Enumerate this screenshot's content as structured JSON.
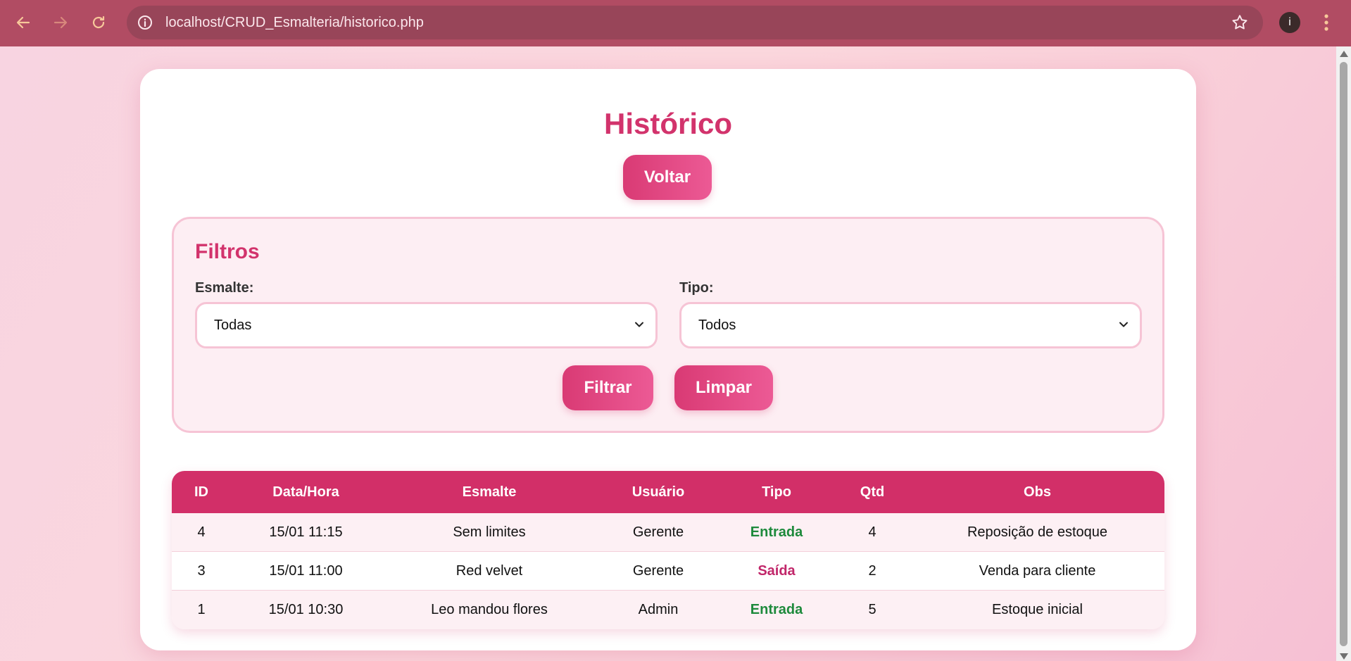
{
  "browser": {
    "url": "localhost/CRUD_Esmalteria/historico.php",
    "profile_initial": "i"
  },
  "page": {
    "title": "Histórico",
    "back_label": "Voltar"
  },
  "filters": {
    "heading": "Filtros",
    "esmalte_label": "Esmalte:",
    "esmalte_value": "Todas",
    "tipo_label": "Tipo:",
    "tipo_value": "Todos",
    "filter_button": "Filtrar",
    "clear_button": "Limpar"
  },
  "table": {
    "headers": [
      "ID",
      "Data/Hora",
      "Esmalte",
      "Usuário",
      "Tipo",
      "Qtd",
      "Obs"
    ],
    "rows": [
      {
        "id": "4",
        "datetime": "15/01 11:15",
        "esmalte": "Sem limites",
        "usuario": "Gerente",
        "tipo": "Entrada",
        "qtd": "4",
        "obs": "Reposição de estoque"
      },
      {
        "id": "3",
        "datetime": "15/01 11:00",
        "esmalte": "Red velvet",
        "usuario": "Gerente",
        "tipo": "Saída",
        "qtd": "2",
        "obs": "Venda para cliente"
      },
      {
        "id": "1",
        "datetime": "15/01 10:30",
        "esmalte": "Leo mandou flores",
        "usuario": "Admin",
        "tipo": "Entrada",
        "qtd": "5",
        "obs": "Estoque inicial"
      }
    ]
  },
  "colors": {
    "accent": "#d2336c",
    "entrada": "#1e8a3c",
    "saida": "#c1276a",
    "chrome": "#b14c63"
  }
}
